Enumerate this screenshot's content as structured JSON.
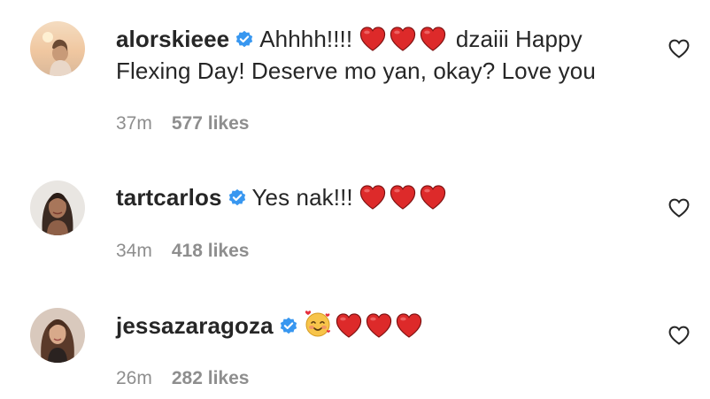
{
  "comments": [
    {
      "username": "alorskieee",
      "verified": true,
      "text_before": "Ahhhh!!!!",
      "hearts": 3,
      "text_after_line1": "dzaiii Happy",
      "text_line2": "Flexing Day! Deserve mo yan, okay? Love you",
      "time": "37m",
      "likes": "577 likes",
      "avatar_icon": "avatar-alorskieee",
      "like_icon": "heart-outline-icon"
    },
    {
      "username": "tartcarlos",
      "verified": true,
      "text_before": "Yes nak!!!",
      "hearts": 3,
      "time": "34m",
      "likes": "418 likes",
      "avatar_icon": "avatar-tartcarlos",
      "like_icon": "heart-outline-icon"
    },
    {
      "username": "jessazaragoza",
      "verified": true,
      "emoji_leading": "smiling-face-with-hearts",
      "hearts": 3,
      "time": "26m",
      "likes": "282 likes",
      "avatar_icon": "avatar-jessazaragoza",
      "like_icon": "heart-outline-icon"
    }
  ],
  "colors": {
    "verified": "#3897f0",
    "heart": "#ed2024",
    "meta_text": "#8e8e8e",
    "text": "#262626"
  }
}
